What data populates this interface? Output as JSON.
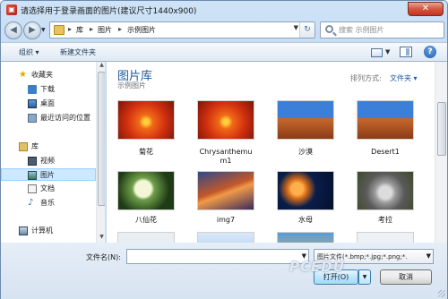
{
  "window": {
    "title": "请选择用于登录画面的图片(建议尺寸1440x900)",
    "close_glyph": "✕"
  },
  "address_bar": {
    "crumbs": [
      "库",
      "图片",
      "示例图片"
    ],
    "separator": "▸"
  },
  "search": {
    "placeholder": "搜索 示例图片"
  },
  "toolbar": {
    "organize": "组织 ▾",
    "new_folder": "新建文件夹",
    "help": "?"
  },
  "nav": {
    "favorites": "收藏夹",
    "downloads": "下载",
    "desktop": "桌面",
    "recent": "最近访问的位置",
    "libraries": "库",
    "videos": "视频",
    "pictures": "图片",
    "documents": "文档",
    "music": "音乐",
    "computer": "计算机"
  },
  "main": {
    "library_title": "图片库",
    "library_sub": "示例图片",
    "arrange_label": "排列方式:",
    "arrange_value": "文件夹 ▾",
    "items": [
      {
        "caption": "菊花"
      },
      {
        "caption": "Chrysanthemum1"
      },
      {
        "caption": "沙漠"
      },
      {
        "caption": "Desert1"
      },
      {
        "caption": "八仙花"
      },
      {
        "caption": "img7"
      },
      {
        "caption": "水母"
      },
      {
        "caption": "考拉"
      }
    ]
  },
  "bottom": {
    "filename_label": "文件名(N):",
    "filename_value": "",
    "filetype": "图片文件(*.bmp;*.jpg;*.png;*.",
    "open": "打开(O)",
    "cancel": "取消"
  },
  "watermark": "PCEDU",
  "colors": {
    "accent": "#1e5ba0",
    "selected": "#cde8ff"
  }
}
